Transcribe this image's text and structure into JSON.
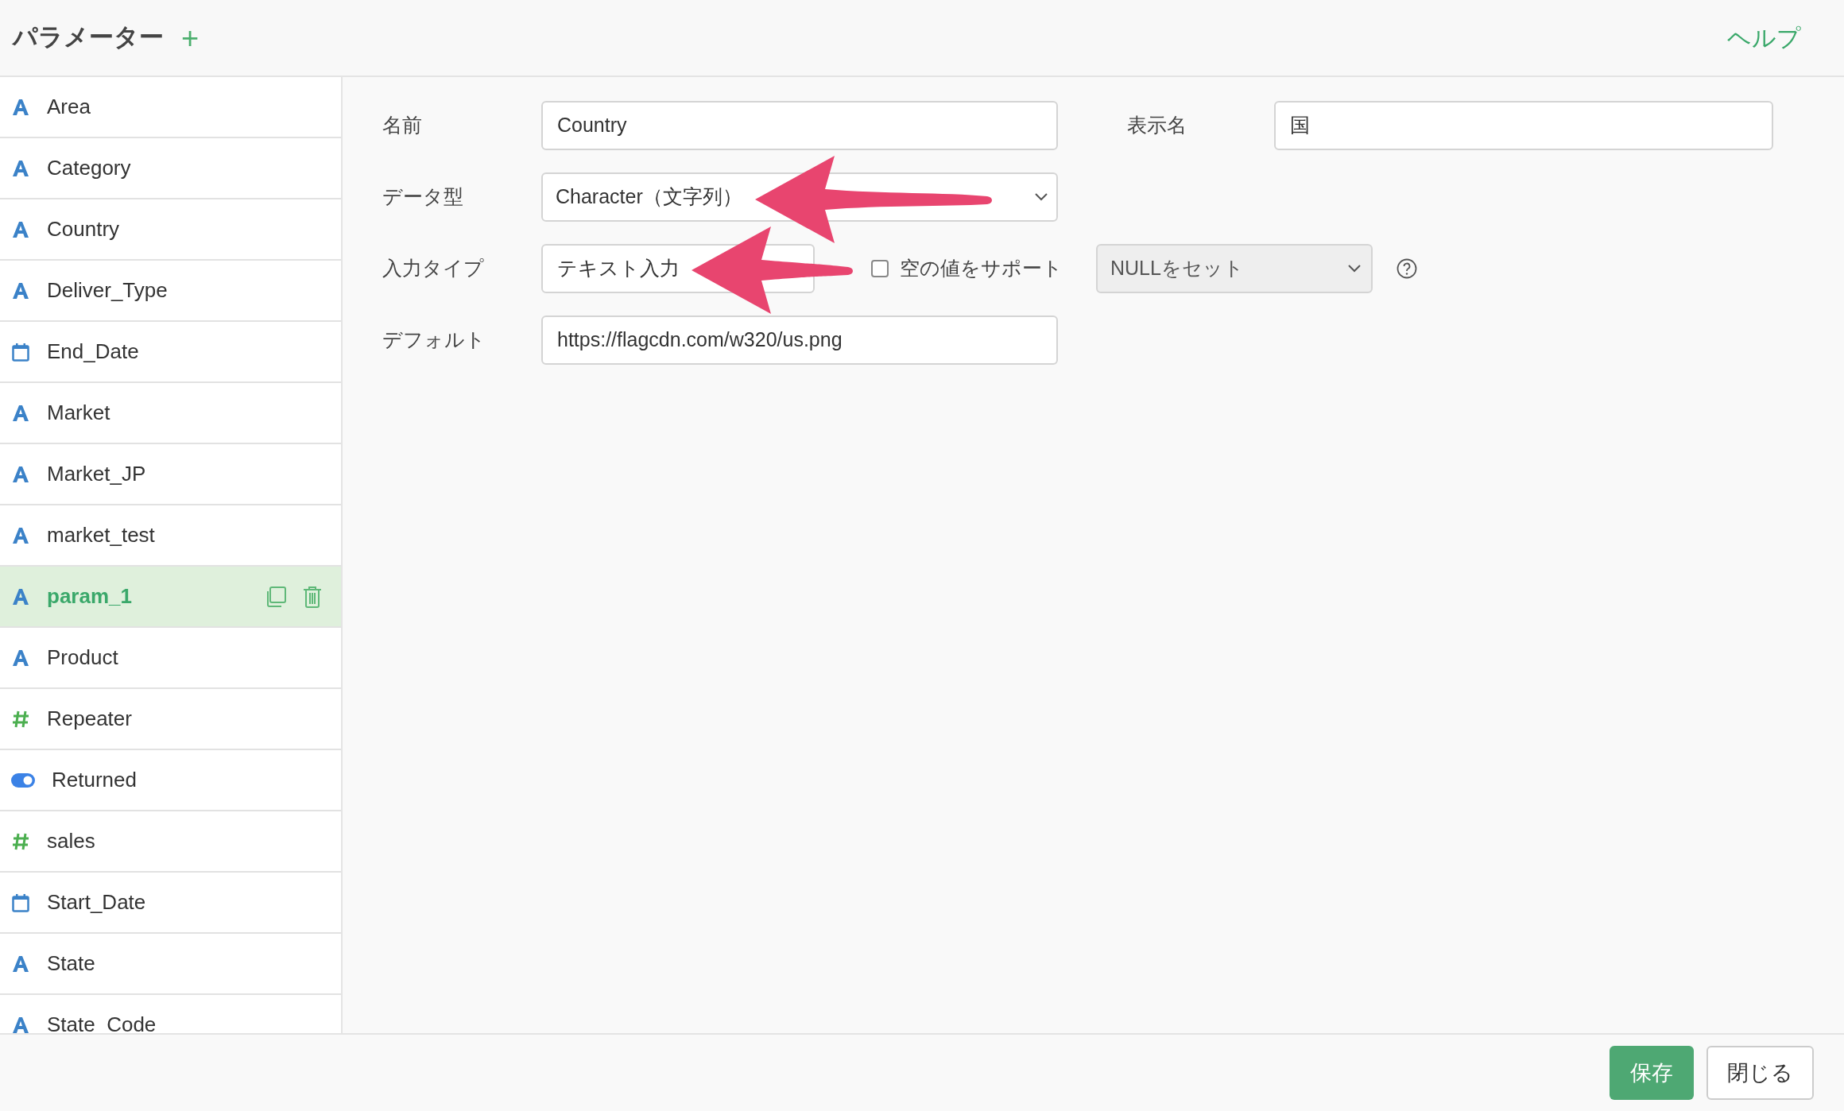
{
  "header": {
    "title": "パラメーター",
    "add_icon_label": "+",
    "help_link": "ヘルプ"
  },
  "sidebar": {
    "items": [
      {
        "kind": "text",
        "name": "Area",
        "selected": false
      },
      {
        "kind": "text",
        "name": "Category",
        "selected": false
      },
      {
        "kind": "text",
        "name": "Country",
        "selected": false
      },
      {
        "kind": "text",
        "name": "Deliver_Type",
        "selected": false
      },
      {
        "kind": "date",
        "name": "End_Date",
        "selected": false
      },
      {
        "kind": "text",
        "name": "Market",
        "selected": false
      },
      {
        "kind": "text",
        "name": "Market_JP",
        "selected": false
      },
      {
        "kind": "text",
        "name": "market_test",
        "selected": false
      },
      {
        "kind": "text",
        "name": "param_1",
        "selected": true
      },
      {
        "kind": "text",
        "name": "Product",
        "selected": false
      },
      {
        "kind": "number",
        "name": "Repeater",
        "selected": false
      },
      {
        "kind": "boolean",
        "name": "Returned",
        "selected": false
      },
      {
        "kind": "number",
        "name": "sales",
        "selected": false
      },
      {
        "kind": "date",
        "name": "Start_Date",
        "selected": false
      },
      {
        "kind": "text",
        "name": "State",
        "selected": false
      },
      {
        "kind": "text",
        "name": "State_Code",
        "selected": false
      }
    ]
  },
  "form": {
    "name": {
      "label": "名前",
      "value": "Country"
    },
    "display_name": {
      "label": "表示名",
      "value": "国"
    },
    "data_type": {
      "label": "データ型",
      "value": "Character（文字列）"
    },
    "input_type": {
      "label": "入力タイプ",
      "value": "テキスト入力"
    },
    "support_empty": {
      "label": "空の値をサポート",
      "checked": false
    },
    "null_option": {
      "value": "NULLをセット",
      "disabled": true
    },
    "default": {
      "label": "デフォルト",
      "value": "https://flagcdn.com/w320/us.png"
    }
  },
  "footer": {
    "buttons": [
      {
        "kind": "primary",
        "label": "保存"
      },
      {
        "kind": "secondary",
        "label": "閉じる"
      }
    ]
  }
}
